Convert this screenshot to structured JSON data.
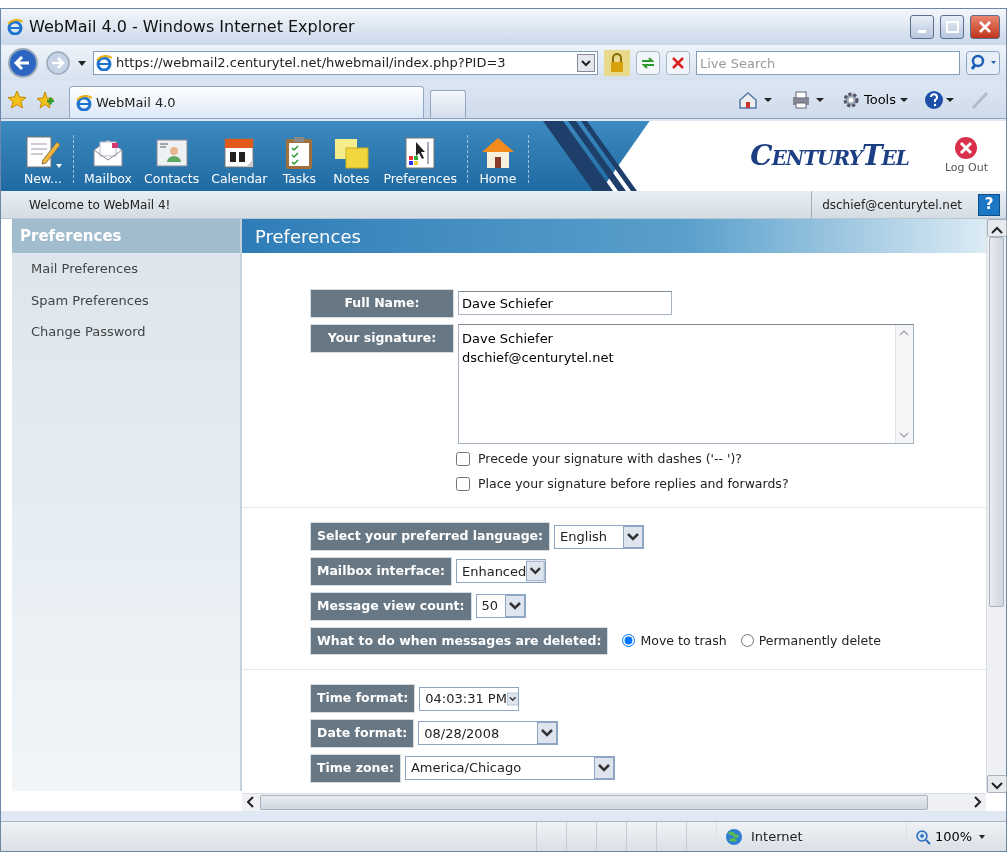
{
  "window": {
    "title": "WebMail 4.0 - Windows Internet Explorer"
  },
  "browser": {
    "address": "https://webmail2.centurytel.net/hwebmail/index.php?PID=3",
    "search_placeholder": "Live Search",
    "tab": "WebMail 4.0",
    "tools": "Tools"
  },
  "toolbar": [
    {
      "label": "New..."
    },
    {
      "label": "Mailbox"
    },
    {
      "label": "Contacts"
    },
    {
      "label": "Calendar"
    },
    {
      "label": "Tasks"
    },
    {
      "label": "Notes"
    },
    {
      "label": "Preferences"
    },
    {
      "label": "Home"
    }
  ],
  "logo": "CenturyTel",
  "logout": "Log Out",
  "welcome": "Welcome to WebMail 4!",
  "user": "dschief@centurytel.net",
  "help": "?",
  "sidebar": {
    "title": "Preferences",
    "items": [
      "Mail Preferences",
      "Spam Preferences",
      "Change Password"
    ]
  },
  "main": {
    "title": "Preferences",
    "full_name": {
      "label": "Full Name:",
      "value": "Dave Schiefer"
    },
    "signature": {
      "label": "Your signature:",
      "value": "Dave Schiefer\ndschief@centurytel.net"
    },
    "checkboxes": [
      {
        "label": "Precede your signature with dashes ('-- ')?",
        "checked": false
      },
      {
        "label": "Place your signature before replies and forwards?",
        "checked": false
      }
    ],
    "selects": [
      {
        "label": "Select your preferred language:",
        "value": "English"
      },
      {
        "label": "Mailbox interface:",
        "value": "Enhanced"
      },
      {
        "label": "Message view count:",
        "value": "50"
      }
    ],
    "delete": {
      "label": "What to do when messages are deleted:",
      "options": [
        {
          "label": "Move to trash",
          "selected": true
        },
        {
          "label": "Permanently delete",
          "selected": false
        }
      ]
    },
    "time_selects": [
      {
        "label": "Time format:",
        "value": "04:03:31 PM"
      },
      {
        "label": "Date format:",
        "value": "08/28/2008"
      },
      {
        "label": "Time zone:",
        "value": "America/Chicago"
      }
    ]
  },
  "status_bar": {
    "zone": "Internet",
    "zoom": "100%"
  }
}
